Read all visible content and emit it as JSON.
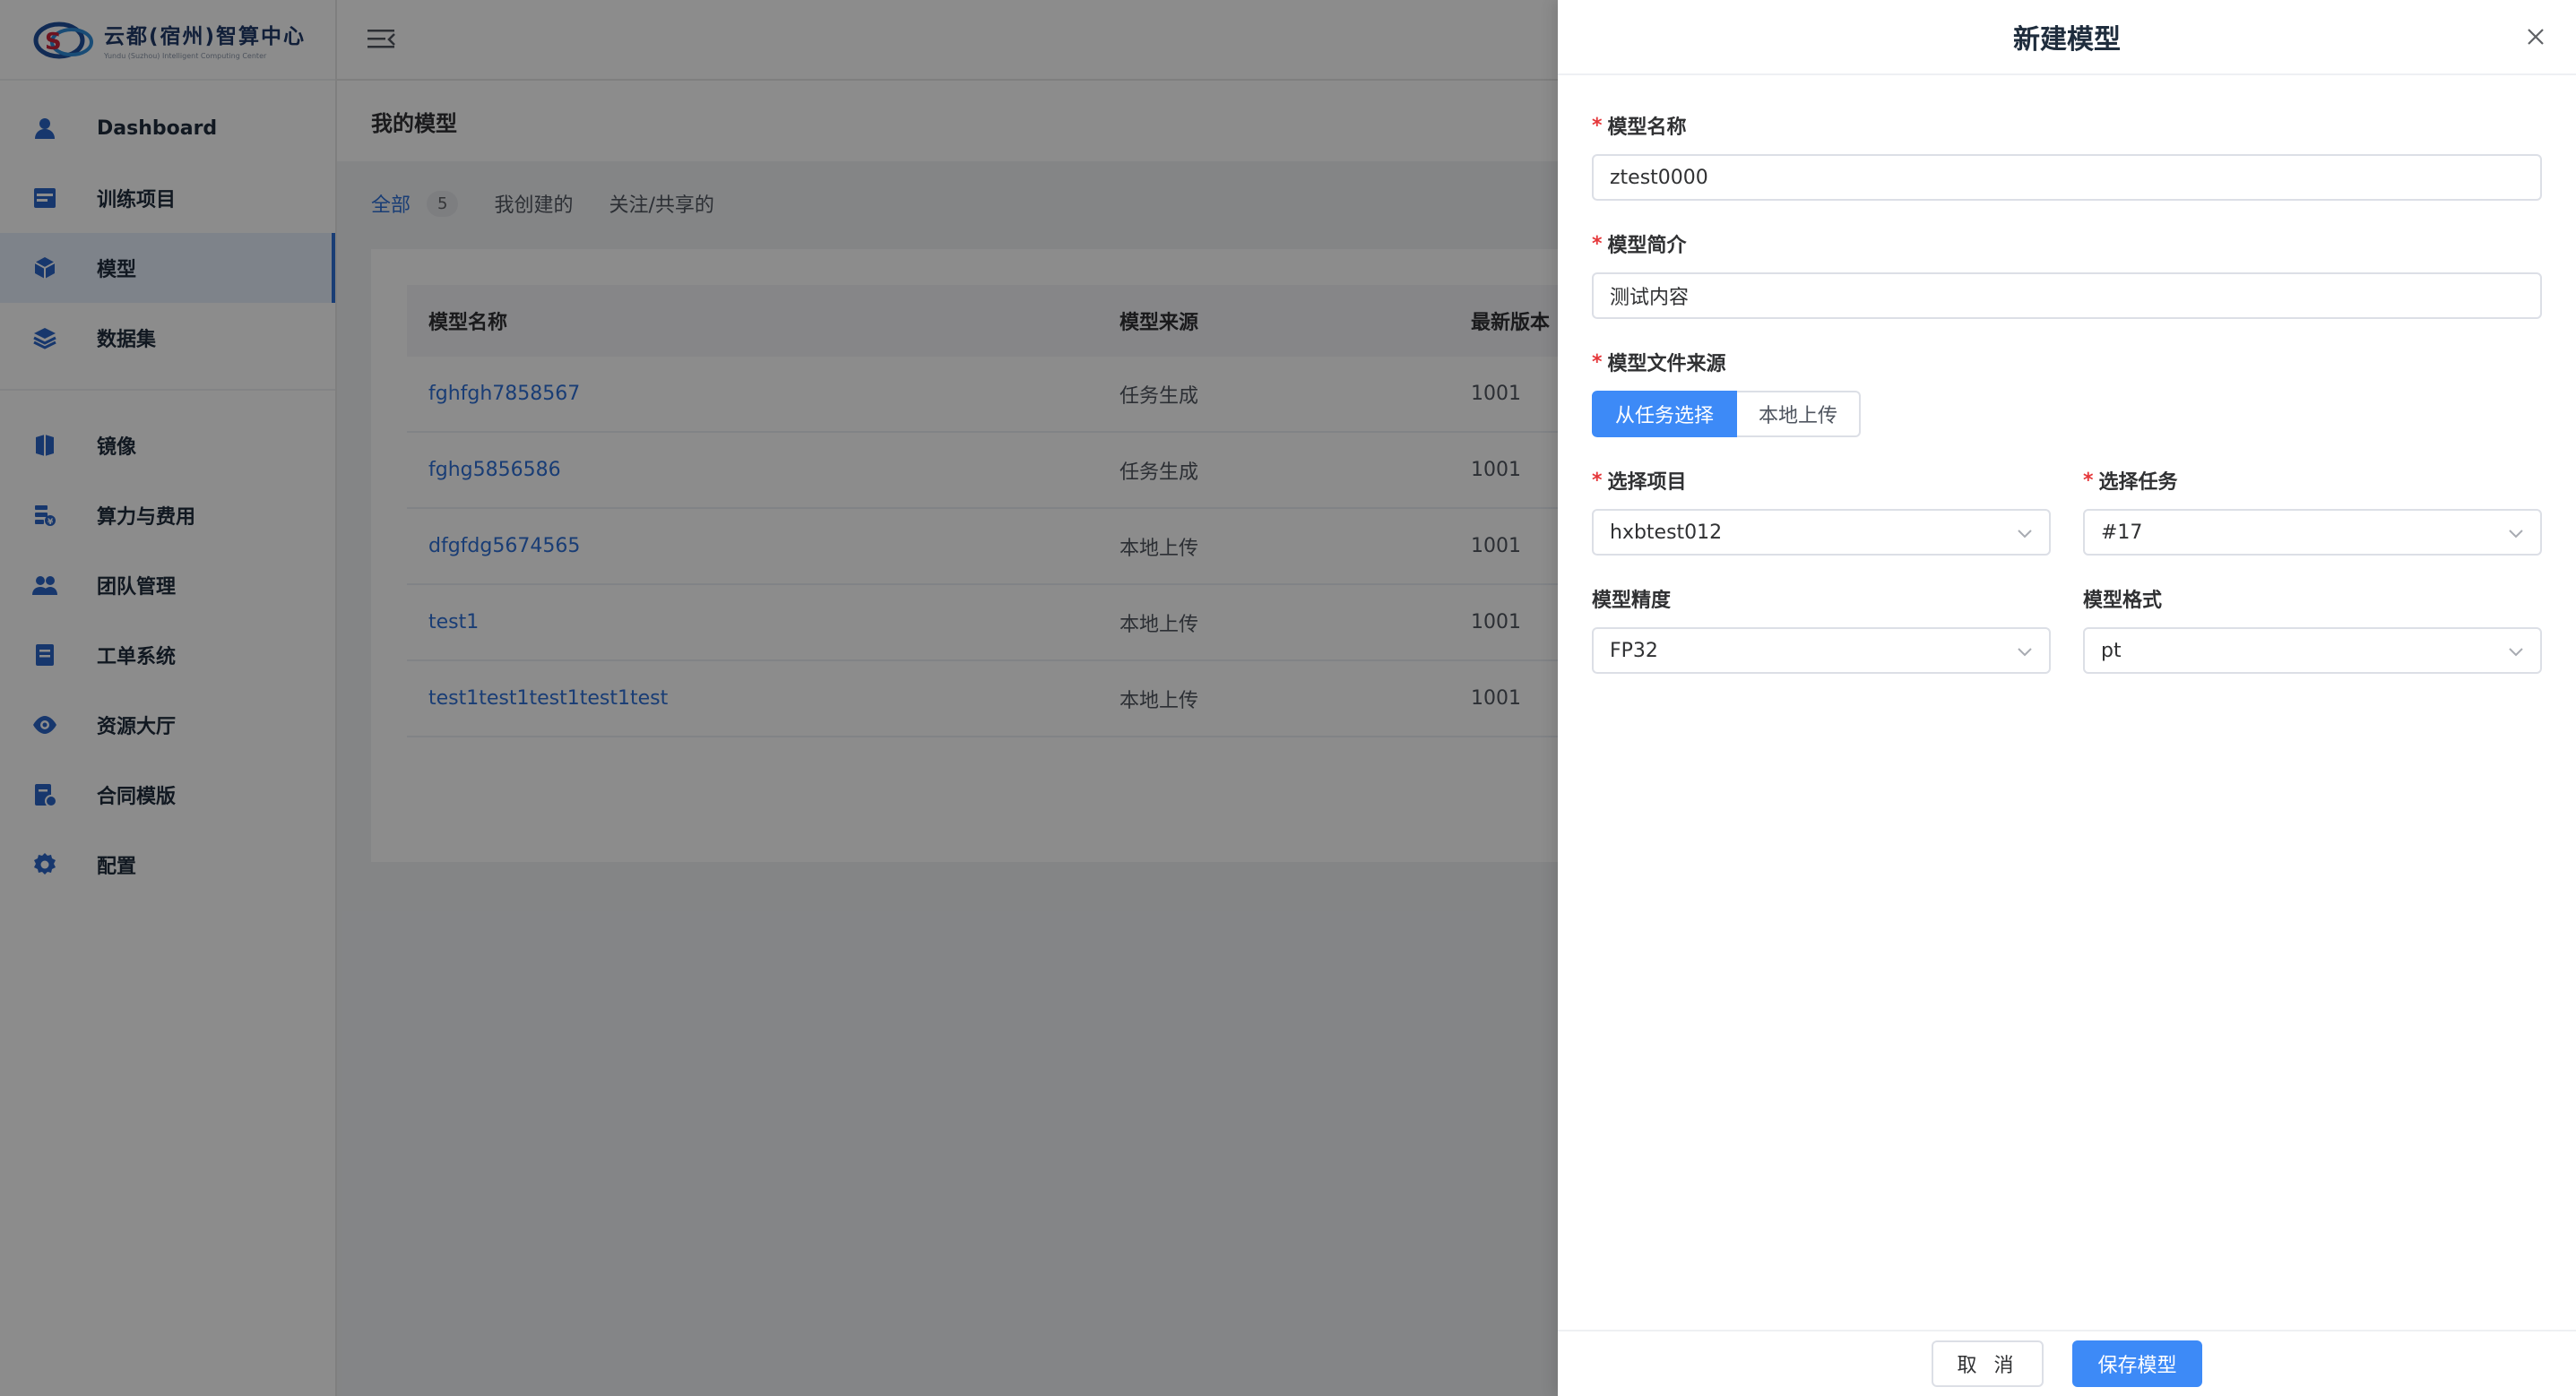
{
  "logo": {
    "title": "云都(宿州)智算中心",
    "subtitle": "Yundu (Suzhou) Intelligent Computing Center"
  },
  "sidebar": {
    "items": [
      {
        "label": "Dashboard",
        "icon": "user-icon"
      },
      {
        "label": "训练项目",
        "icon": "project-icon"
      },
      {
        "label": "模型",
        "icon": "cube-icon",
        "active": true
      },
      {
        "label": "数据集",
        "icon": "layers-icon"
      },
      {
        "label": "镜像",
        "icon": "image-icon"
      },
      {
        "label": "算力与费用",
        "icon": "billing-icon"
      },
      {
        "label": "团队管理",
        "icon": "team-icon"
      },
      {
        "label": "工单系统",
        "icon": "ticket-icon"
      },
      {
        "label": "资源大厅",
        "icon": "eye-icon"
      },
      {
        "label": "合同模版",
        "icon": "contract-icon"
      },
      {
        "label": "配置",
        "icon": "gear-icon"
      }
    ]
  },
  "page": {
    "title": "我的模型",
    "tabs": [
      {
        "label": "全部",
        "count": "5",
        "active": true
      },
      {
        "label": "我创建的"
      },
      {
        "label": "关注/共享的"
      }
    ],
    "table": {
      "headers": [
        "模型名称",
        "模型来源",
        "最新版本"
      ],
      "rows": [
        {
          "name": "fghfgh7858567",
          "source": "任务生成",
          "version": "1001"
        },
        {
          "name": "fghg5856586",
          "source": "任务生成",
          "version": "1001"
        },
        {
          "name": "dfgfdg5674565",
          "source": "本地上传",
          "version": "1001"
        },
        {
          "name": "test1",
          "source": "本地上传",
          "version": "1001"
        },
        {
          "name": "test1test1test1test1test",
          "source": "本地上传",
          "version": "1001"
        }
      ]
    }
  },
  "drawer": {
    "title": "新建模型",
    "name_label": "模型名称",
    "name_value": "ztest0000",
    "intro_label": "模型简介",
    "intro_value": "测试内容",
    "source_label": "模型文件来源",
    "source_options": [
      "从任务选择",
      "本地上传"
    ],
    "project_label": "选择项目",
    "project_value": "hxbtest012",
    "task_label": "选择任务",
    "task_value": "#17",
    "precision_label": "模型精度",
    "precision_value": "FP32",
    "format_label": "模型格式",
    "format_value": "pt",
    "cancel_label": "取 消",
    "save_label": "保存模型"
  },
  "colors": {
    "primary": "#3d8af7",
    "link": "#2f6fd6",
    "required": "#e5373a"
  }
}
